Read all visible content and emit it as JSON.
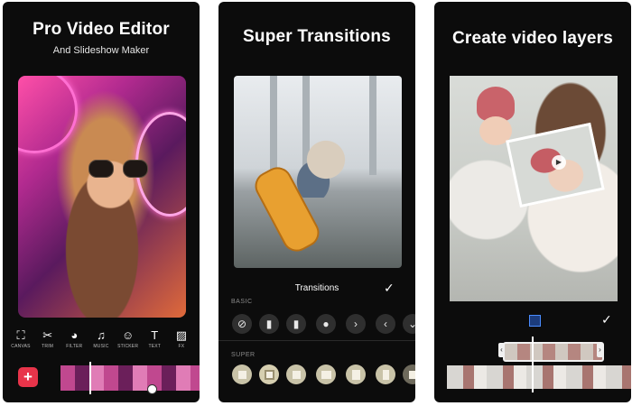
{
  "panels": {
    "editor": {
      "headline": "Pro Video Editor",
      "subline": "And Slideshow Maker",
      "tools": [
        {
          "label": "CANVAS",
          "glyph": "⛶",
          "icon": "canvas-icon"
        },
        {
          "label": "TRIM",
          "glyph": "✂",
          "icon": "scissors-icon"
        },
        {
          "label": "FILTER",
          "glyph": "◕",
          "icon": "filter-icon"
        },
        {
          "label": "MUSIC",
          "glyph": "♫",
          "icon": "music-icon"
        },
        {
          "label": "STICKER",
          "glyph": "☺",
          "icon": "sticker-icon"
        },
        {
          "label": "TEXT",
          "glyph": "T",
          "icon": "text-icon"
        },
        {
          "label": "FX",
          "glyph": "▨",
          "icon": "fx-icon"
        }
      ],
      "add_glyph": "+"
    },
    "transitions": {
      "headline": "Super Transitions",
      "title": "Transitions",
      "check": "✓",
      "basic_label": "BASIC",
      "super_label": "SUPER",
      "basic_glyphs": [
        "⊘",
        "▮",
        "▮",
        "●",
        "›",
        "‹",
        "⌄"
      ],
      "super_count": 7
    },
    "layers": {
      "headline": "Create video layers",
      "check": "✓",
      "play_glyph": "▶",
      "handle_left": "‹",
      "handle_right": "›"
    }
  },
  "colors": {
    "panel_bg": "#0c0c0c",
    "accent_red": "#e8344a",
    "layer_blue": "#4a8cff"
  }
}
